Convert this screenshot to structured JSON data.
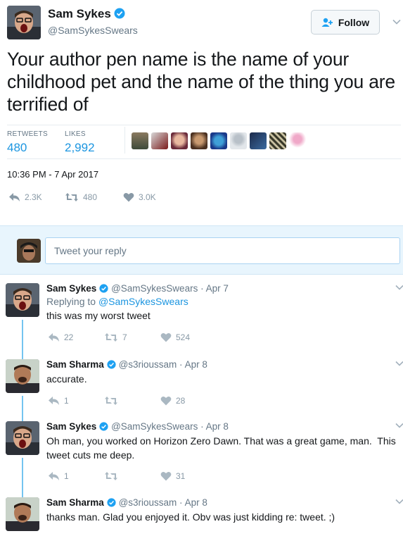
{
  "main_tweet": {
    "author_name": "Sam Sykes",
    "author_handle": "@SamSykesSwears",
    "follow_label": "Follow",
    "text": "Your author pen name is the name of your childhood pet and the name of the thing you are terrified of",
    "retweets_label": "RETWEETS",
    "retweets_value": "480",
    "likes_label": "LIKES",
    "likes_value": "2,992",
    "timestamp": "10:36 PM - 7 Apr 2017",
    "reply_count": "2.3K",
    "retweet_count": "480",
    "like_count": "3.0K"
  },
  "reply_box": {
    "placeholder": "Tweet your reply"
  },
  "replies": [
    {
      "name": "Sam Sykes",
      "handle": "@SamSykesSwears",
      "date": "Apr 7",
      "replying_label": "Replying to",
      "replying_to": "@SamSykesSwears",
      "text": "this was my worst tweet",
      "reply_count": "22",
      "retweet_count": "7",
      "like_count": "524"
    },
    {
      "name": "Sam Sharma",
      "handle": "@s3rioussam",
      "date": "Apr 8",
      "text": "accurate.",
      "reply_count": "1",
      "retweet_count": "",
      "like_count": "28"
    },
    {
      "name": "Sam Sykes",
      "handle": "@SamSykesSwears",
      "date": "Apr 8",
      "text": "Oh man, you worked on Horizon Zero Dawn. That was a great game, man.  This tweet cuts me deep.",
      "reply_count": "1",
      "retweet_count": "",
      "like_count": "31"
    },
    {
      "name": "Sam Sharma",
      "handle": "@s3rioussam",
      "date": "Apr 8",
      "text": "thanks man. Glad you enjoyed it. Obv was just kidding re: tweet. ;)"
    }
  ],
  "colors": {
    "accent": "#1b95e0",
    "verified": "#1da1f2",
    "muted": "#657786",
    "icon": "#8899a6",
    "thread_line": "#74c4f0",
    "reply_bar_bg": "#e8f5fd"
  },
  "icons": [
    "verified-badge-icon",
    "follow-user-icon",
    "chevron-down-icon",
    "reply-icon",
    "retweet-icon",
    "like-icon"
  ]
}
